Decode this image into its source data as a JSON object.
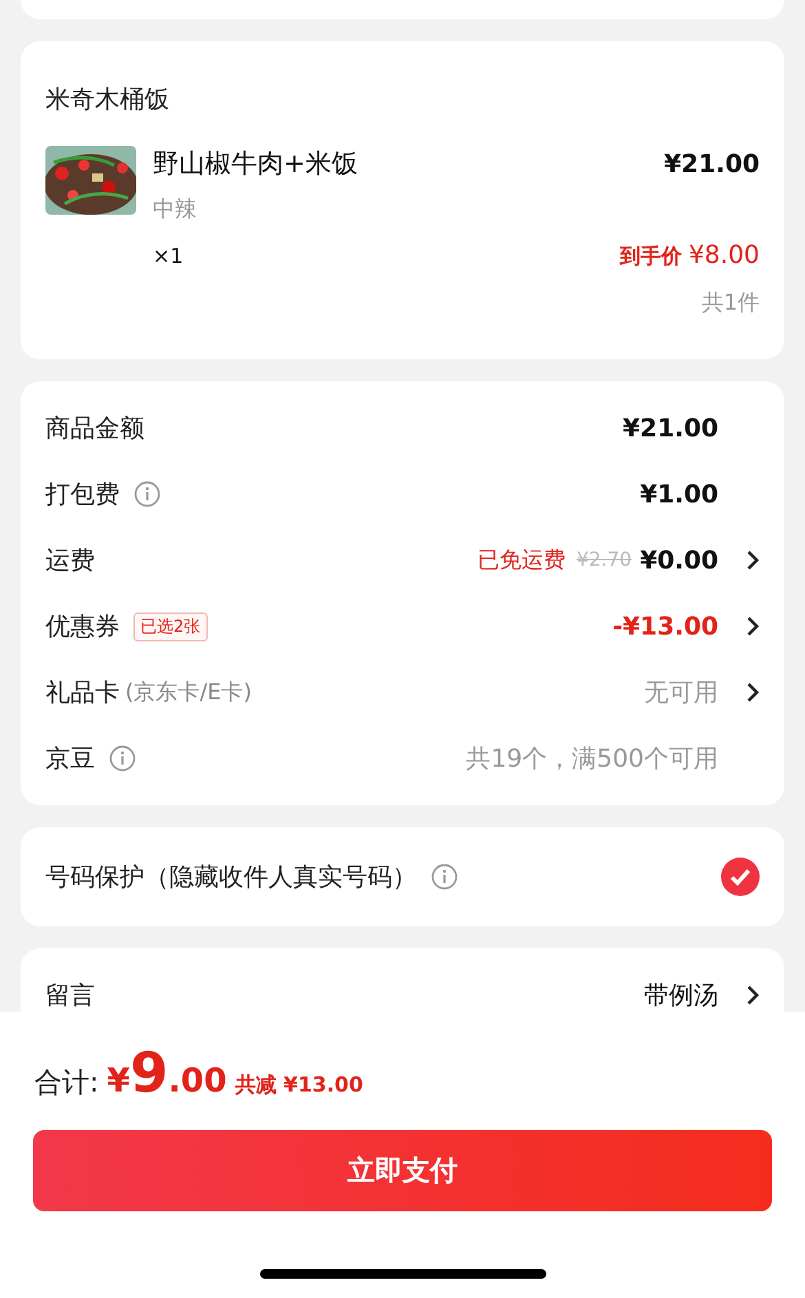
{
  "store": {
    "name": "米奇木桶饭",
    "items": [
      {
        "kind": "picture",
        "name": "野山椒牛肉+米饭",
        "spec": "中辣",
        "quantity": "×1",
        "price": "¥21.00",
        "final_label": "到手价",
        "final_price": "¥8.00"
      }
    ],
    "count": "共1件"
  },
  "fees": [
    {
      "label": "商品金额",
      "value": "¥21.00",
      "color": "#111111",
      "info": false,
      "arrow": false
    },
    {
      "label": "打包费",
      "value": "¥1.00",
      "color": "#111111",
      "info": true,
      "arrow": false
    },
    {
      "label": "运费",
      "promo": "已免运费",
      "original": "¥2.70",
      "value": "¥0.00",
      "color": "#111111",
      "info": false,
      "arrow": true
    },
    {
      "label": "优惠券",
      "tag": "已选2张",
      "value": "-¥13.00",
      "color": "#e2231a",
      "info": false,
      "arrow": true
    },
    {
      "label": "礼品卡",
      "note": "(京东卡/E卡)",
      "value": "无可用",
      "color": "#999999",
      "info": false,
      "arrow": true
    },
    {
      "label": "京豆",
      "value": "共19个，满500个可用",
      "color": "#999999",
      "info": true,
      "arrow": false
    }
  ],
  "phone_protection": {
    "label": "号码保护（隐藏收件人真实号码）",
    "info": true,
    "checked": true
  },
  "message": {
    "label": "留言",
    "value": "带例汤"
  },
  "footer": {
    "total_label": "合计:",
    "currency": "¥",
    "integer": "9",
    "decimal": ".00",
    "saved": "共减 ¥13.00",
    "pay_button": "立即支付"
  }
}
